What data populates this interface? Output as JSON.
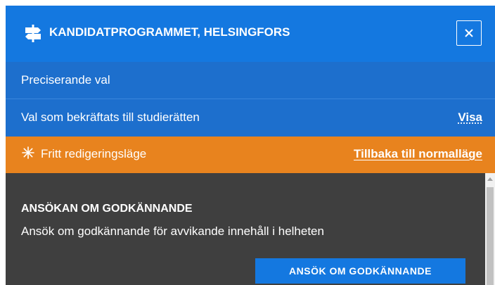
{
  "header": {
    "title": "KANDIDATPROGRAMMET, HELSINGFORS",
    "close_label": "×"
  },
  "rows": {
    "precise_choices": "Preciserande val",
    "confirmed_choices": "Val som bekräftats till studierätten",
    "confirmed_link": "Visa",
    "edit_mode": "Fritt redigeringsläge",
    "edit_mode_link": "Tillbaka till normalläge"
  },
  "content": {
    "heading": "ANSÖKAN OM GODKÄNNANDE",
    "description": "Ansök om godkännande för avvikande innehåll i helheten",
    "apply_button": "ANSÖK OM GODKÄNNANDE"
  },
  "icons": {
    "header_icon": "signpost-icon",
    "close_icon": "close-icon",
    "edit_icon": "sparkle-icon"
  },
  "colors": {
    "primary_blue": "#1478e0",
    "row_blue": "#1d6fcd",
    "edit_orange": "#e8831e",
    "content_dark": "#3f3f3f"
  }
}
